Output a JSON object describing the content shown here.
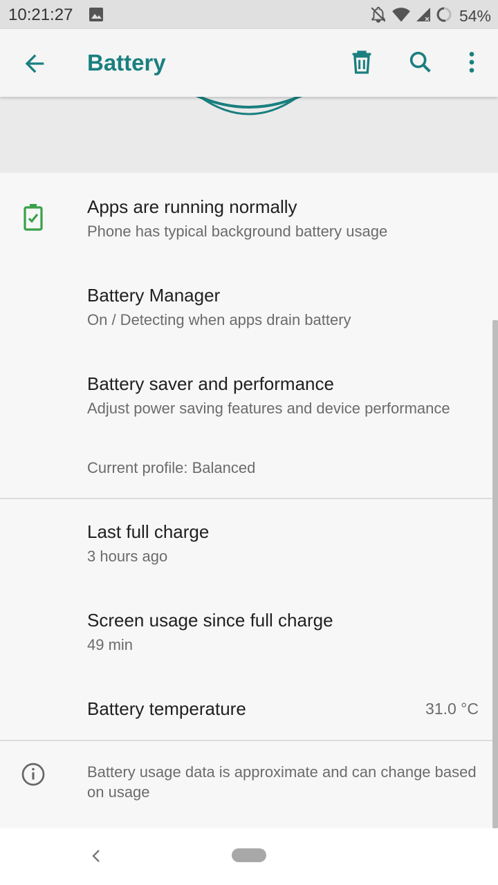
{
  "status_bar": {
    "time": "10:21:27",
    "battery_percent": "54%",
    "icons": [
      "image-icon",
      "notifications-off-icon",
      "wifi-icon",
      "cellular-signal-icon",
      "battery-ring-icon"
    ]
  },
  "app_bar": {
    "title": "Battery",
    "actions": [
      "back-icon",
      "delete-icon",
      "search-icon",
      "more-vert-icon"
    ]
  },
  "items": {
    "apps_running": {
      "title": "Apps are running normally",
      "subtitle": "Phone has typical background battery usage",
      "icon": "battery-check-icon"
    },
    "battery_manager": {
      "title": "Battery Manager",
      "subtitle": "On / Detecting when apps drain battery"
    },
    "battery_saver": {
      "title": "Battery saver and performance",
      "subtitle": "Adjust power saving features and device performance",
      "profile": "Current profile: Balanced"
    },
    "last_full_charge": {
      "title": "Last full charge",
      "subtitle": "3 hours ago"
    },
    "screen_usage": {
      "title": "Screen usage since full charge",
      "subtitle": "49 min"
    },
    "battery_temperature": {
      "title": "Battery temperature",
      "value": "31.0 °C"
    },
    "info": {
      "text": "Battery usage data is approximate and can change based on usage",
      "icon": "info-icon"
    }
  },
  "colors": {
    "accent": "#1a7f7f",
    "battery_ok": "#3aa04a"
  }
}
